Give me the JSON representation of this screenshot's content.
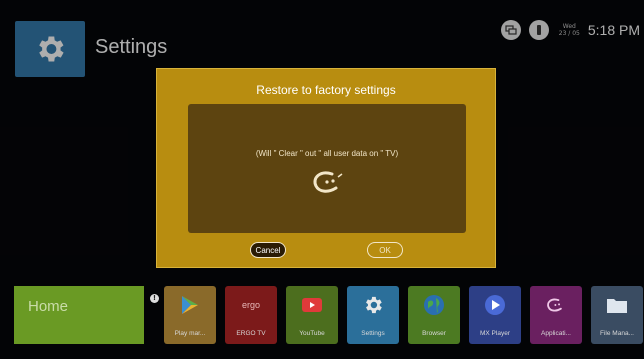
{
  "header": {
    "title": "Settings",
    "date_day": "Wed",
    "date_num": "23 / 05",
    "time": "5:18 PM"
  },
  "dialog": {
    "title": "Restore to factory settings",
    "message": "(Will \" Clear \" out \" all user data on \" TV)",
    "cancel_label": "Cancel",
    "ok_label": "OK"
  },
  "home": {
    "label": "Home"
  },
  "apps": [
    {
      "label": "Play mar...",
      "icon": "play-store-icon",
      "color": "#8a6a2a"
    },
    {
      "label": "ERGO TV",
      "icon": "ergo-tv-icon",
      "color": "#7c1a1a"
    },
    {
      "label": "YouTube",
      "icon": "youtube-icon",
      "color": "#4c6e1e"
    },
    {
      "label": "Settings",
      "icon": "gear-icon",
      "color": "#2b6f9a"
    },
    {
      "label": "Browser",
      "icon": "globe-icon",
      "color": "#4c7a22"
    },
    {
      "label": "MX Player",
      "icon": "mx-player-icon",
      "color": "#2d3f86"
    },
    {
      "label": "Applicati...",
      "icon": "apps-icon",
      "color": "#6a2060"
    },
    {
      "label": "File Mana...",
      "icon": "folder-icon",
      "color": "#3a4c62"
    }
  ],
  "colors": {
    "dialog_bg": "#b88d10",
    "dialog_panel": "#5d4410",
    "home_tile": "#6a9a24"
  }
}
